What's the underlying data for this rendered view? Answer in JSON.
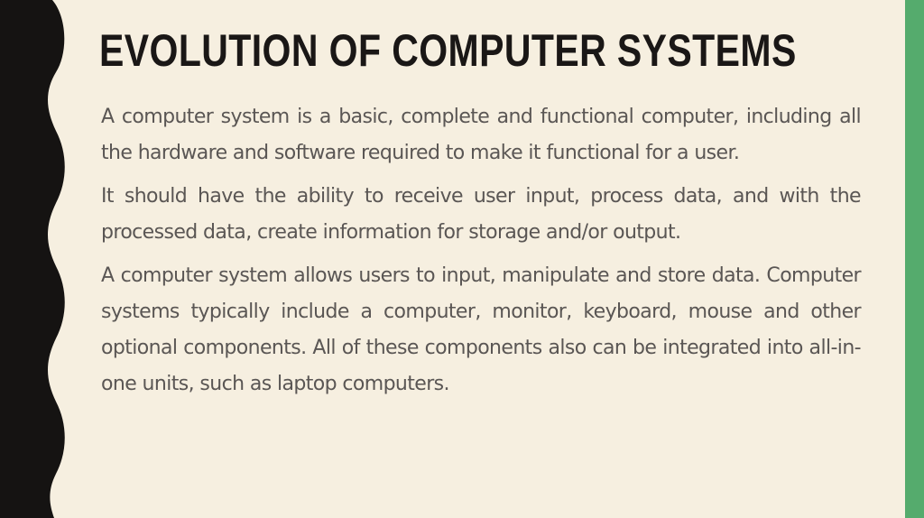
{
  "slide": {
    "title": "Evolution of Computer Systems",
    "paragraphs": [
      "A computer system is a basic, complete and functional computer, including all the hardware and software required to make it functional for a user.",
      "It should have the ability to receive user input, process data, and with the processed data, create information for storage and/or output.",
      "A computer system allows users to input, manipulate and store data. Computer systems typically include a computer, monitor, keyboard, mouse and other optional components. All of these components also can be integrated into all-in-one units, such as laptop computers."
    ],
    "colors": {
      "background": "#f6efe0",
      "left_band": "#151312",
      "accent_bar": "#55ab6d",
      "title": "#1a1716",
      "body_text": "#5a5654"
    }
  }
}
